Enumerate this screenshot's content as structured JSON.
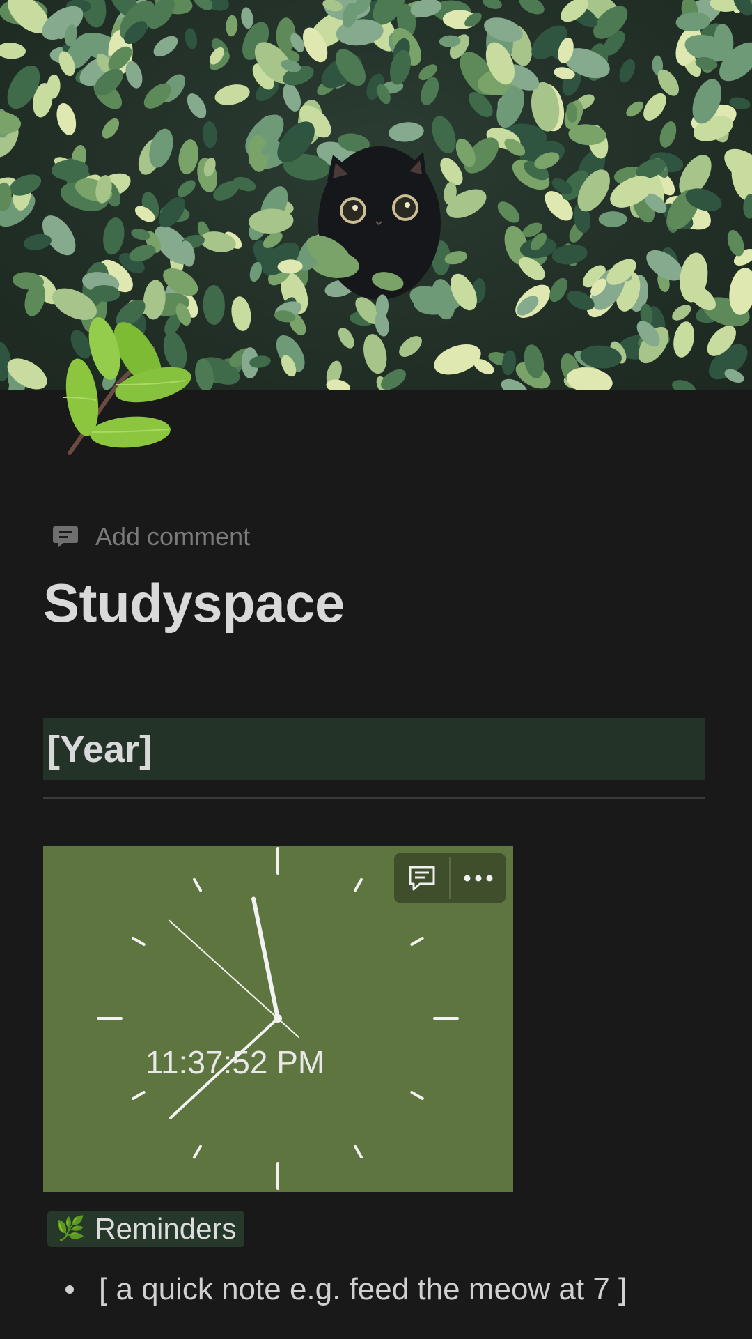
{
  "page": {
    "title": "Studyspace",
    "add_comment_label": "Add comment",
    "page_icon": "herb-branch-icon",
    "cover": "cat-in-leaves-cover"
  },
  "year_block": {
    "text": "[Year]"
  },
  "clock_widget": {
    "time": "11:37:52 PM",
    "background_color": "#5e753f",
    "toolbar": {
      "comment_icon": "comment-icon",
      "more_icon": "more-icon"
    }
  },
  "reminders": {
    "label": "Reminders",
    "icon": "🌿",
    "items": [
      "[ a quick note e.g. feed the meow at 7 ]"
    ]
  },
  "colors": {
    "background": "#191919",
    "heading_block": "#233328",
    "tag": "#253829"
  }
}
